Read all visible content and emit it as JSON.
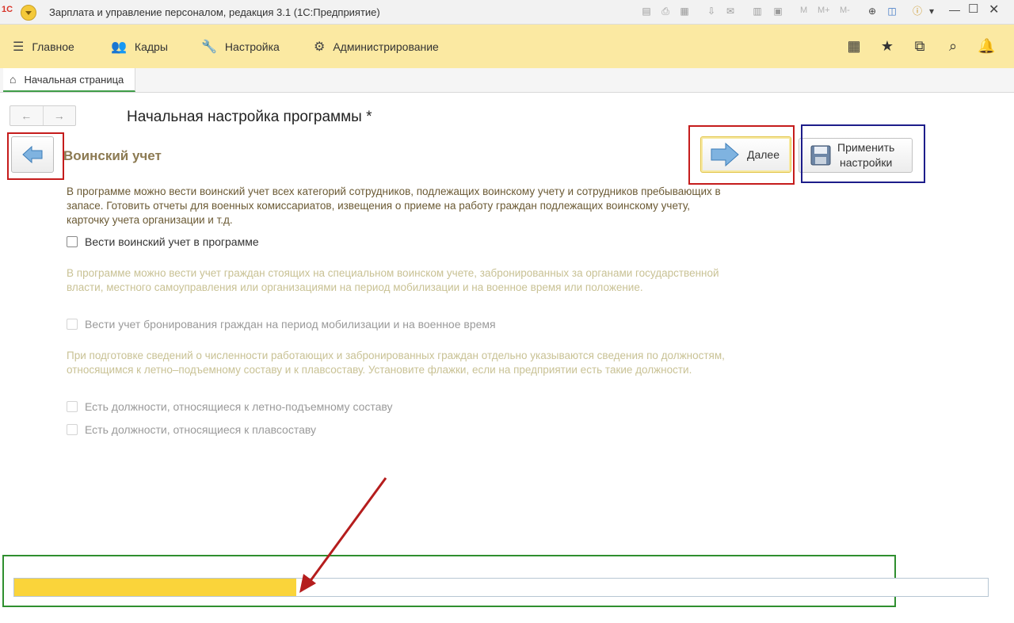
{
  "window": {
    "title": "Зарплата и управление персоналом, редакция 3.1  (1С:Предприятие)",
    "logo_text": "1С",
    "toolbar_letters": [
      "M",
      "M+",
      "M-"
    ]
  },
  "sections": {
    "items": [
      {
        "label": "Главное"
      },
      {
        "label": "Кадры"
      },
      {
        "label": "Настройка"
      },
      {
        "label": "Администрирование"
      }
    ]
  },
  "tabs": {
    "home_label": "Начальная страница"
  },
  "form": {
    "title": "Начальная настройка программы *",
    "section_title": "Воинский учет",
    "next_label": "Далее",
    "apply_label_line1": "Применить",
    "apply_label_line2": "настройки"
  },
  "content": {
    "para1": "В программе можно вести воинский учет всех категорий сотрудников, подлежащих воинскому учету и сотрудников пребывающих в запасе. Готовить отчеты для военных комиссариатов, извещения о приеме на работу граждан подлежащих воинскому учету, карточку учета организации и т.д.",
    "cb1_label": "Вести воинский учет в программе",
    "para2": "В программе можно вести учет граждан стоящих на специальном воинском учете, забронированных за органами государственной власти, местного самоуправления или организациями на период мобилизации и на военное время или положение.",
    "cb2_label": "Вести учет бронирования граждан на период мобилизации и на военное время",
    "para3": "При подготовке сведений о численности работающих и забронированных граждан отдельно указываются сведения по должностям, относящимся к летно–подъемному составу и к плавсоставу. Установите флажки, если на предприятии есть такие должности.",
    "cb3_label": "Есть должности, относящиеся к летно-подъемному составу",
    "cb4_label": "Есть должности, относящиеся к плавсоставу"
  },
  "progress": {
    "fraction": 0.29,
    "fill_color": "#fad43a"
  },
  "colors": {
    "section_bar": "#fbe9a2",
    "annotation_red": "#c51c1c",
    "annotation_blue": "#1d1d8a",
    "annotation_green": "#2f8f2f"
  }
}
